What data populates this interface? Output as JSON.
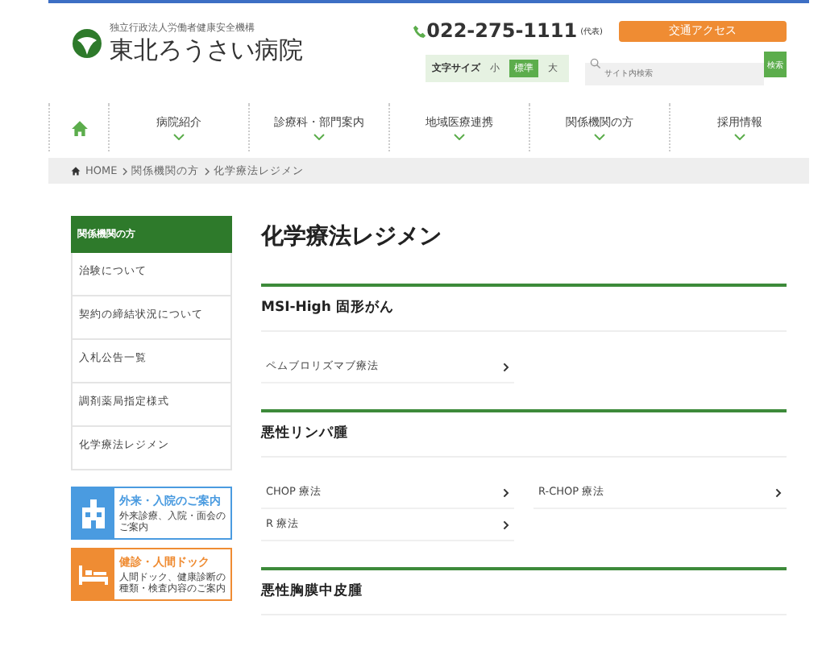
{
  "header": {
    "org": "独立行政法人労働者健康安全機構",
    "name": "東北ろうさい病院",
    "phone": "022-275-1111",
    "phone_note": "(代表)",
    "access_button": "交通アクセス",
    "font_size": {
      "label": "文字サイズ",
      "options": [
        {
          "label": "小",
          "selected": false
        },
        {
          "label": "標準",
          "selected": true
        },
        {
          "label": "大",
          "selected": false
        }
      ]
    },
    "search": {
      "placeholder": "サイト内検索",
      "button": "検索"
    }
  },
  "nav": [
    "病院紹介",
    "診療科・部門案内",
    "地域医療連携",
    "関係機関の方",
    "採用情報"
  ],
  "breadcrumb": [
    "HOME",
    "関係機関の方",
    "化学療法レジメン"
  ],
  "sidebar": {
    "title": "関係機関の方",
    "items": [
      "治験について",
      "契約の締結状況について",
      "入札公告一覧",
      "調剤薬局指定様式",
      "化学療法レジメン"
    ],
    "banners": [
      {
        "kind": "hospital",
        "title": "外来・入院のご案内",
        "text": "外来診療、入院・面会のご案内"
      },
      {
        "kind": "bed",
        "title": "健診・人間ドック",
        "text": "人間ドック、健康診断の種類・検査内容のご案内"
      }
    ]
  },
  "main": {
    "title": "化学療法レジメン",
    "sections": [
      {
        "title": "MSI-High 固形がん",
        "items": [
          "ペムブロリズマブ療法"
        ]
      },
      {
        "title": "悪性リンパ腫",
        "items": [
          "CHOP 療法",
          "R-CHOP 療法",
          "R 療法"
        ]
      },
      {
        "title": "悪性胸膜中皮腫"
      }
    ]
  }
}
